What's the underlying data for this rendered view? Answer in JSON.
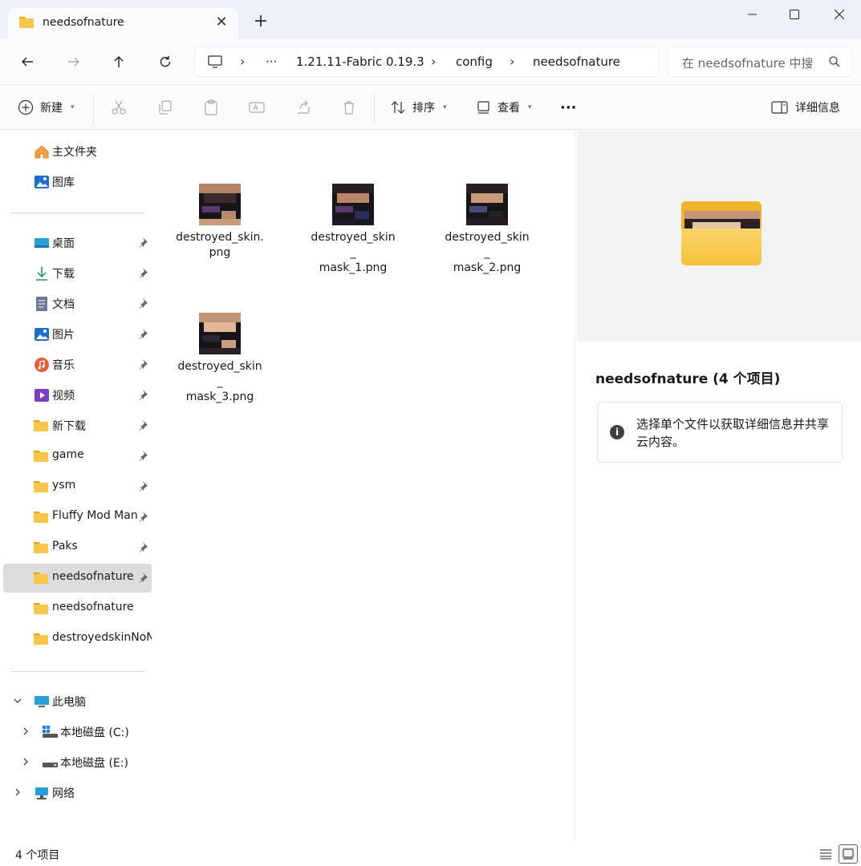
{
  "tab": {
    "title": "needsofnature",
    "close": "✕",
    "new_tab": "+"
  },
  "window": {
    "minimize": "—",
    "maximize": "☐",
    "close": "✕"
  },
  "address": {
    "ellipsis": "···",
    "segments": [
      "1.21.11-Fabric 0.19.3",
      "config",
      "needsofnature"
    ],
    "chevron": "›"
  },
  "search": {
    "placeholder": "在 needsofnature 中搜索"
  },
  "commands": {
    "new": "新建",
    "sort": "排序",
    "view": "查看",
    "more": "···",
    "details": "详细信息"
  },
  "sidebar": {
    "top": [
      {
        "label": "主文件夹",
        "icon": "home-icon"
      },
      {
        "label": "图库",
        "icon": "gallery-icon"
      }
    ],
    "quick": [
      {
        "label": "桌面",
        "icon": "desktop-icon",
        "pinned": true
      },
      {
        "label": "下载",
        "icon": "download-icon",
        "pinned": true
      },
      {
        "label": "文档",
        "icon": "document-icon",
        "pinned": true
      },
      {
        "label": "图片",
        "icon": "pictures-icon",
        "pinned": true
      },
      {
        "label": "音乐",
        "icon": "music-icon",
        "pinned": true
      },
      {
        "label": "视频",
        "icon": "video-icon",
        "pinned": true
      },
      {
        "label": "新下载",
        "icon": "folder-icon",
        "pinned": true
      },
      {
        "label": "game",
        "icon": "folder-icon",
        "pinned": true
      },
      {
        "label": "ysm",
        "icon": "folder-icon",
        "pinned": true
      },
      {
        "label": "Fluffy Mod Manager",
        "icon": "folder-icon",
        "pinned": true
      },
      {
        "label": "Paks",
        "icon": "folder-icon",
        "pinned": true
      },
      {
        "label": "needsofnature",
        "icon": "folder-icon",
        "pinned": true,
        "selected": true
      },
      {
        "label": "needsofnature",
        "icon": "folder-icon",
        "pinned": false
      },
      {
        "label": "destroyedskinNoNeeds",
        "icon": "folder-icon",
        "pinned": false
      }
    ],
    "pc": {
      "label": "此电脑",
      "icon": "computer-icon"
    },
    "drives": [
      {
        "label": "本地磁盘 (C:)",
        "icon": "windows-drive-icon"
      },
      {
        "label": "本地磁盘 (E:)",
        "icon": "drive-icon"
      }
    ],
    "network": {
      "label": "网络",
      "icon": "network-icon"
    }
  },
  "files": [
    {
      "name": "destroyed_skin.\npng"
    },
    {
      "name": "destroyed_skin_\nmask_1.png"
    },
    {
      "name": "destroyed_skin_\nmask_2.png"
    },
    {
      "name": "destroyed_skin_\nmask_3.png"
    }
  ],
  "details_pane": {
    "title": "needsofnature (4 个项目)",
    "info": "选择单个文件以获取详细信息并共享云内容。"
  },
  "status": {
    "count": "4 个项目"
  },
  "colors": {
    "accent": "#0067c0",
    "folder": "#f7c64b",
    "selection": "#dcdcdc"
  }
}
